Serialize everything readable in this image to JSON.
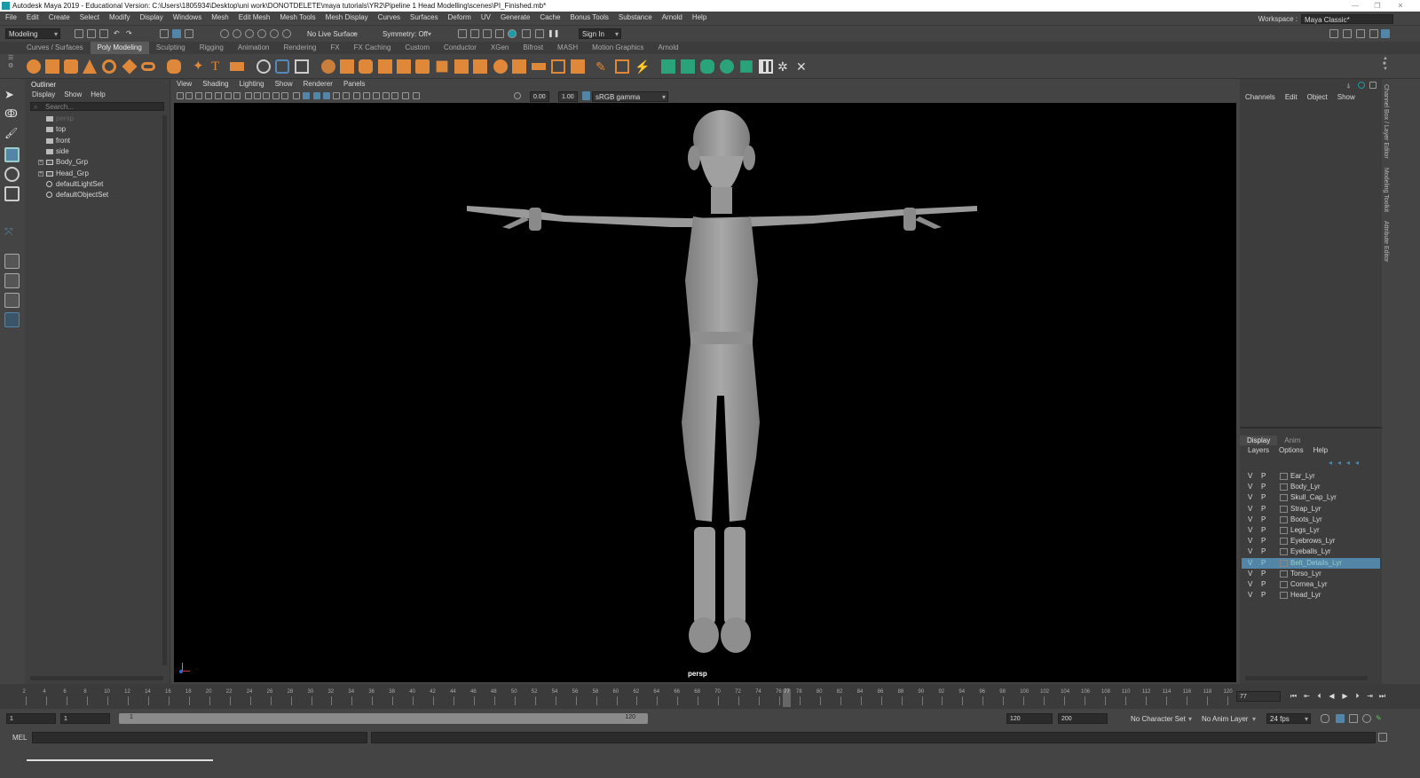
{
  "window": {
    "title": "Autodesk Maya 2019 - Educational Version: C:\\Users\\1805934\\Desktop\\uni work\\DONOTDELETE\\maya tutorials\\YR2\\Pipeline 1 Head Modelling\\scenes\\PI_Finished.mb*"
  },
  "menubar": [
    "File",
    "Edit",
    "Create",
    "Select",
    "Modify",
    "Display",
    "Windows",
    "Mesh",
    "Edit Mesh",
    "Mesh Tools",
    "Mesh Display",
    "Curves",
    "Surfaces",
    "Deform",
    "UV",
    "Generate",
    "Cache",
    "Bonus Tools",
    "Substance",
    "Arnold",
    "Help"
  ],
  "workspace": {
    "label": "Workspace :",
    "value": "Maya Classic*"
  },
  "statusline": {
    "menuset": "Modeling",
    "live_surface": "No Live Surface",
    "symmetry": "Symmetry: Off",
    "sign_in": "Sign In"
  },
  "shelf_tabs": [
    "Curves / Surfaces",
    "Poly Modeling",
    "Sculpting",
    "Rigging",
    "Animation",
    "Rendering",
    "FX",
    "FX Caching",
    "Custom",
    "Conductor",
    "XGen",
    "Bifrost",
    "MASH",
    "Motion Graphics",
    "Arnold"
  ],
  "shelf_active_tab": "Poly Modeling",
  "outliner": {
    "title": "Outliner",
    "menu": [
      "Display",
      "Show",
      "Help"
    ],
    "search_placeholder": "Search...",
    "items": [
      {
        "label": "persp",
        "type": "camera",
        "dim": true
      },
      {
        "label": "top",
        "type": "camera"
      },
      {
        "label": "front",
        "type": "camera"
      },
      {
        "label": "side",
        "type": "camera"
      },
      {
        "label": "Body_Grp",
        "type": "group",
        "expandable": true
      },
      {
        "label": "Head_Grp",
        "type": "group",
        "expandable": true
      },
      {
        "label": "defaultLightSet",
        "type": "set"
      },
      {
        "label": "defaultObjectSet",
        "type": "set"
      }
    ]
  },
  "viewport": {
    "menu": [
      "View",
      "Shading",
      "Lighting",
      "Show",
      "Renderer",
      "Panels"
    ],
    "exposure": "0.00",
    "gamma": "1.00",
    "color_space": "sRGB gamma",
    "camera_label": "persp"
  },
  "channelbox": {
    "menu": [
      "Channels",
      "Edit",
      "Object",
      "Show"
    ]
  },
  "side_tabs": [
    "Channel Box / Layer Editor",
    "Modeling Toolkit",
    "Attribute Editor"
  ],
  "layer_editor": {
    "tabs": [
      "Display",
      "Anim"
    ],
    "menu": [
      "Layers",
      "Options",
      "Help"
    ],
    "layers": [
      {
        "v": "V",
        "p": "P",
        "name": "Ear_Lyr"
      },
      {
        "v": "V",
        "p": "P",
        "name": "Body_Lyr"
      },
      {
        "v": "V",
        "p": "P",
        "name": "Skull_Cap_Lyr"
      },
      {
        "v": "V",
        "p": "P",
        "name": "Strap_Lyr"
      },
      {
        "v": "V",
        "p": "P",
        "name": "Boots_Lyr"
      },
      {
        "v": "V",
        "p": "P",
        "name": "Legs_Lyr"
      },
      {
        "v": "V",
        "p": "P",
        "name": "Eyebrows_Lyr"
      },
      {
        "v": "V",
        "p": "P",
        "name": "Eyeballs_Lyr"
      },
      {
        "v": "V",
        "p": "P",
        "name": "Belt_Details_Lyr",
        "selected": true
      },
      {
        "v": "V",
        "p": "P",
        "name": "Torso_Lyr"
      },
      {
        "v": "V",
        "p": "P",
        "name": "Cornea_Lyr"
      },
      {
        "v": "V",
        "p": "P",
        "name": "Head_Lyr"
      }
    ]
  },
  "timeline": {
    "ticks": [
      "2",
      "4",
      "6",
      "8",
      "10",
      "12",
      "14",
      "16",
      "18",
      "20",
      "22",
      "24",
      "26",
      "28",
      "30",
      "32",
      "34",
      "36",
      "38",
      "40",
      "42",
      "44",
      "46",
      "48",
      "50",
      "52",
      "54",
      "56",
      "58",
      "60",
      "62",
      "64",
      "66",
      "68",
      "70",
      "72",
      "74",
      "76",
      "78",
      "80",
      "82",
      "84",
      "86",
      "88",
      "90",
      "92",
      "94",
      "96",
      "98",
      "100",
      "102",
      "104",
      "106",
      "108",
      "110",
      "112",
      "114",
      "116",
      "118",
      "120"
    ],
    "current_frame": "77",
    "current_frame_field": "77"
  },
  "range": {
    "start": "1",
    "playback_start": "1",
    "slider_start": "1",
    "slider_end": "120",
    "playback_end": "120",
    "end": "200",
    "character_set": "No Character Set",
    "anim_layer": "No Anim Layer",
    "fps": "24 fps"
  },
  "cmdline": {
    "lang": "MEL"
  },
  "colors": {
    "accent": "#5285a6",
    "shelf_icon": "#e0883a",
    "viewport_bg": "#000000",
    "model": "#9a9a9a"
  }
}
